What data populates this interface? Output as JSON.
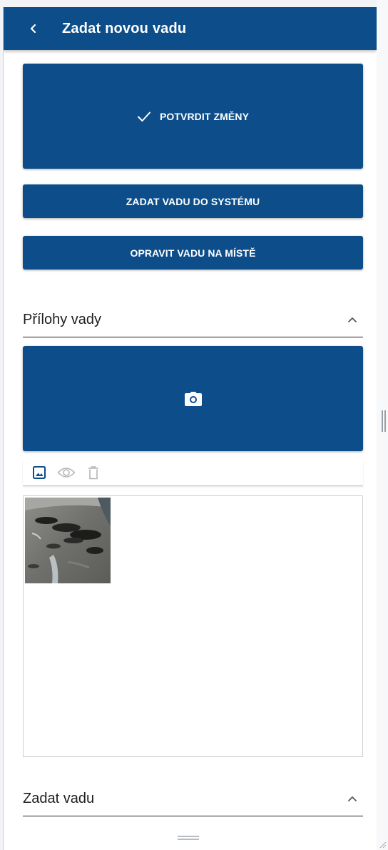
{
  "header": {
    "title": "Zadat novou vadu",
    "back_icon": "chevron-left-icon"
  },
  "actions": {
    "confirm_label": "POTVRDIT ZMĚNY",
    "system_label": "ZADAT VADU DO SYSTÉMU",
    "fix_label": "OPRAVIT VADU NA MÍSTĚ"
  },
  "attachments": {
    "title": "Přílohy vady",
    "expanded": true,
    "camera_icon": "camera-icon",
    "toolbar": [
      "image-icon",
      "eye-icon",
      "trash-icon"
    ],
    "thumbnails": 1
  },
  "defect_section": {
    "title": "Zadat vadu",
    "expanded": true
  },
  "colors": {
    "primary": "#0c4d8a",
    "text": "#1e1e1e",
    "muted_icon": "#b5b5b5"
  }
}
